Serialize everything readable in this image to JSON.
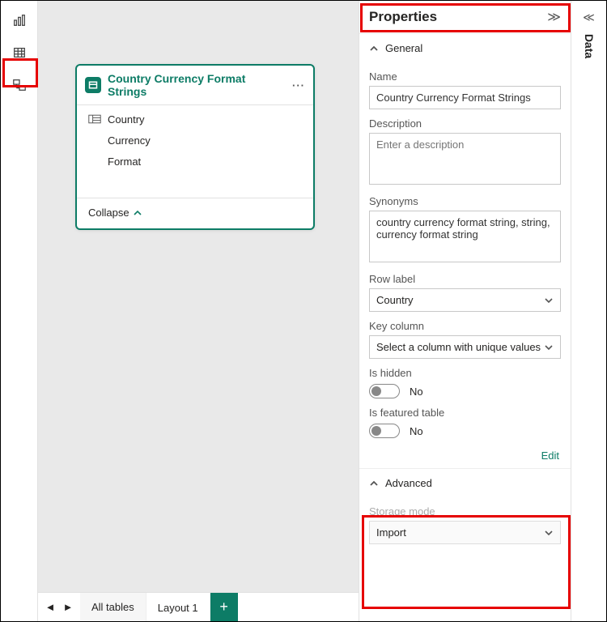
{
  "panel": {
    "title": "Properties"
  },
  "general": {
    "heading": "General",
    "name_label": "Name",
    "name_value": "Country Currency Format Strings",
    "desc_label": "Description",
    "desc_placeholder": "Enter a description",
    "syn_label": "Synonyms",
    "syn_value": "country currency format string, string, currency format string",
    "rowlabel_label": "Row label",
    "rowlabel_value": "Country",
    "keycol_label": "Key column",
    "keycol_value": "Select a column with unique values",
    "hidden_label": "Is hidden",
    "hidden_value": "No",
    "featured_label": "Is featured table",
    "featured_value": "No",
    "edit_link": "Edit"
  },
  "advanced": {
    "heading": "Advanced",
    "storage_label": "Storage mode",
    "storage_value": "Import"
  },
  "table_card": {
    "title": "Country Currency Format Strings",
    "cols": [
      "Country",
      "Currency",
      "Format"
    ],
    "collapse": "Collapse"
  },
  "bottom": {
    "tab1": "All tables",
    "tab2": "Layout 1"
  },
  "rightbar": {
    "label": "Data"
  }
}
